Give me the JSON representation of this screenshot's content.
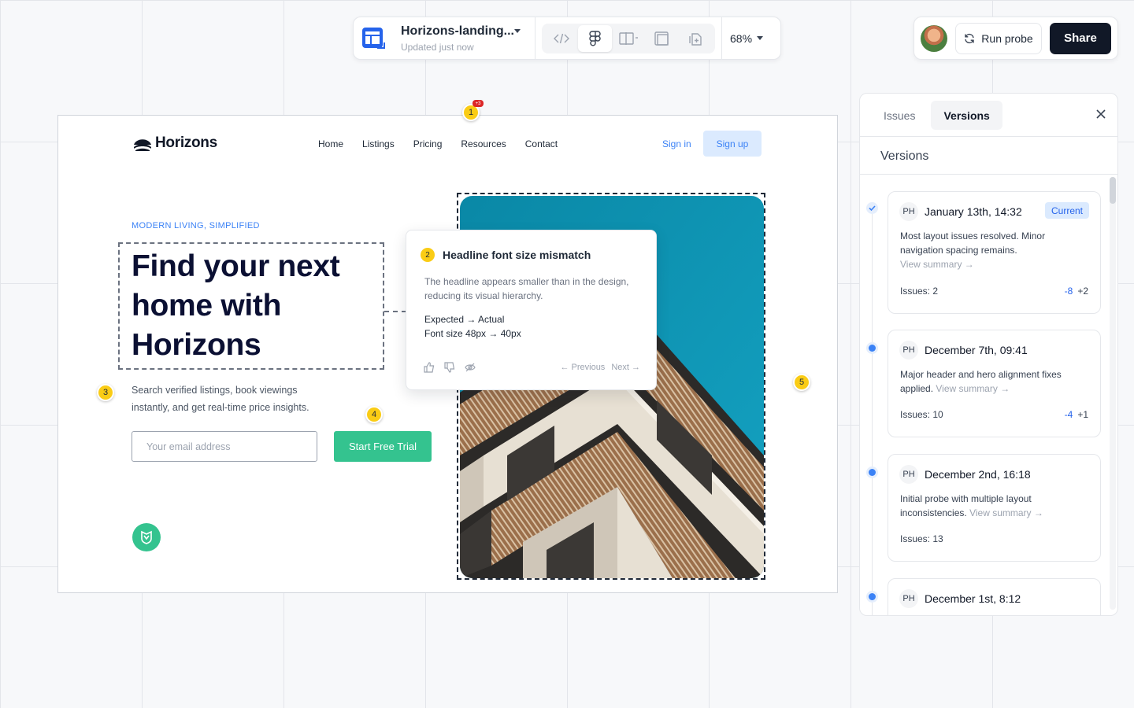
{
  "toolbar": {
    "file_name": "Horizons-landing...",
    "file_status": "Updated just now",
    "zoom": "68%",
    "modes": [
      "code-icon",
      "figma-icon",
      "split-view-icon",
      "overlay-icon",
      "export-icon"
    ]
  },
  "actions": {
    "run_probe": "Run probe",
    "share": "Share"
  },
  "site": {
    "logo": "Horizons",
    "nav": [
      "Home",
      "Listings",
      "Pricing",
      "Resources",
      "Contact"
    ],
    "sign_in": "Sign in",
    "sign_up": "Sign up",
    "eyebrow": "MODERN LIVING, SIMPLIFIED",
    "headline": "Find your next home with Horizons",
    "subtext": "Search verified listings, book viewings instantly, and get real-time price insights.",
    "email_placeholder": "Your email address",
    "cta": "Start Free Trial"
  },
  "markers": {
    "m1": "1",
    "m1_count": "+3",
    "m3": "3",
    "m4": "4",
    "m5": "5"
  },
  "popover": {
    "number": "2",
    "title": "Headline font size mismatch",
    "description": "The headline appears smaller than in the design, reducing its visual hierarchy.",
    "compare_label": "Expected → Actual",
    "compare_value": "Font size 48px → 40px",
    "prev": "← Previous",
    "next": "Next →"
  },
  "panel": {
    "tabs": [
      "Issues",
      "Versions"
    ],
    "active_tab": "Versions",
    "heading": "Versions",
    "versions": [
      {
        "initials": "PH",
        "date": "January 13th, 14:32",
        "badge": "Current",
        "text": "Most layout issues resolved. Minor navigation spacing remains.",
        "link": "View summary →",
        "issues": "Issues: 2",
        "minus": "-8",
        "plus": "+2"
      },
      {
        "initials": "PH",
        "date": "December 7th, 09:41",
        "text": "Major header and hero alignment fixes applied.",
        "link": "View summary →",
        "issues": "Issues: 10",
        "minus": "-4",
        "plus": "+1"
      },
      {
        "initials": "PH",
        "date": "December 2nd, 16:18",
        "text": "Initial probe with multiple layout inconsistencies.",
        "link": "View summary →",
        "issues": "Issues: 13"
      },
      {
        "initials": "PH",
        "date": "December 1st, 8:12"
      }
    ]
  },
  "colors": {
    "accent": "#3b82f6",
    "cta_green": "#34c38f",
    "marker_yellow": "#facc15",
    "headline_navy": "#0b1033",
    "sky_teal": "#0b8fae"
  }
}
